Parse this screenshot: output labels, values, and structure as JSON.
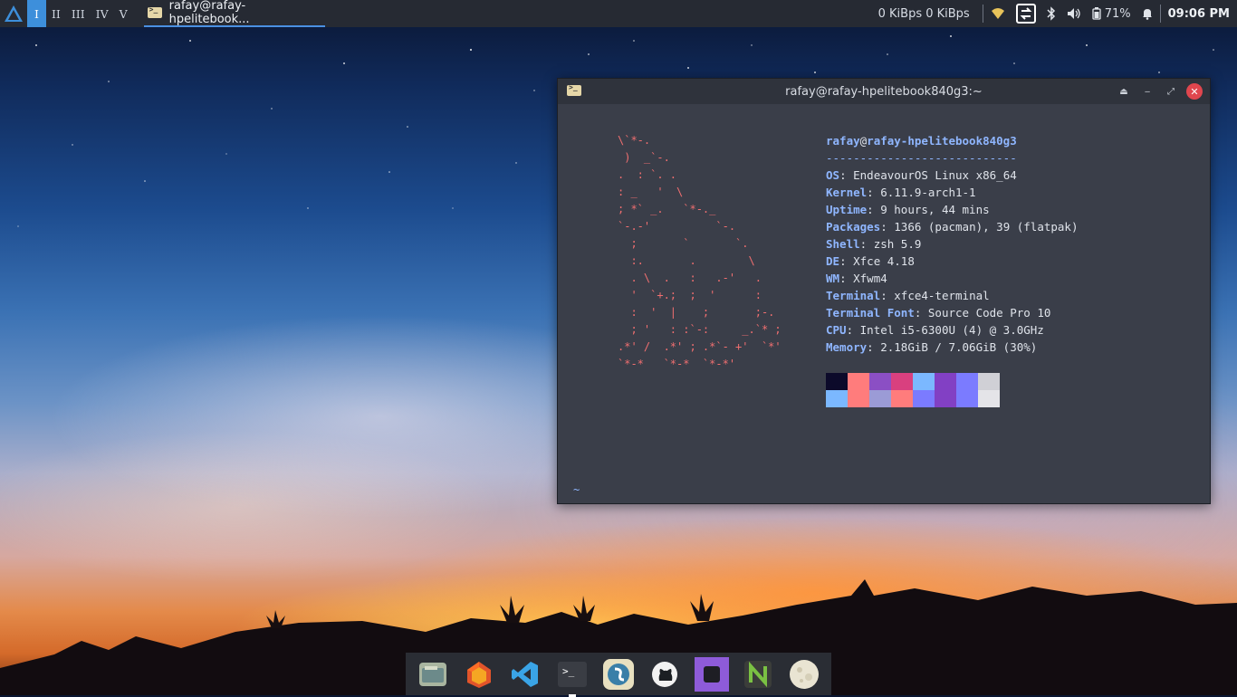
{
  "panel": {
    "workspaces": [
      "I",
      "II",
      "III",
      "IV",
      "V"
    ],
    "active_workspace": "I",
    "task_title": "rafay@rafay-hpelitebook...",
    "net_speed": "0 KiBps 0 KiBps",
    "battery": "71%",
    "clock": "09:06 PM",
    "tray_icons": [
      "wifi-icon",
      "screen-rotate-icon",
      "bluetooth-icon",
      "volume-icon",
      "battery-icon",
      "notification-bell-icon"
    ]
  },
  "terminal": {
    "title": "rafay@rafay-hpelitebook840g3:~",
    "ascii_art": "\\`*-.\n )  _`-.\n.  : `. .\n: _   '  \\\n; *` _.   `*-._\n`-.-'          `-.\n  ;       `       `.\n  :.       .        \\\n  . \\  .   :   .-'   .\n  '  `+.;  ;  '      :\n  :  '  |    ;       ;-.\n  ; '   : :`-:     _.`* ;\n.*' /  .*' ; .*`- +'  `*'\n`*-*   `*-*  `*-*'",
    "user": "rafay",
    "at": "@",
    "host": "rafay-hpelitebook840g3",
    "separator": "----------------------------",
    "info": [
      {
        "key": "OS",
        "value": "EndeavourOS Linux x86_64"
      },
      {
        "key": "Kernel",
        "value": "6.11.9-arch1-1"
      },
      {
        "key": "Uptime",
        "value": "9 hours, 44 mins"
      },
      {
        "key": "Packages",
        "value": "1366 (pacman), 39 (flatpak)"
      },
      {
        "key": "Shell",
        "value": "zsh 5.9"
      },
      {
        "key": "DE",
        "value": "Xfce 4.18"
      },
      {
        "key": "WM",
        "value": "Xfwm4"
      },
      {
        "key": "Terminal",
        "value": "xfce4-terminal"
      },
      {
        "key": "Terminal Font",
        "value": "Source Code Pro 10"
      },
      {
        "key": "CPU",
        "value": "Intel i5-6300U (4) @ 3.0GHz"
      },
      {
        "key": "Memory",
        "value": "2.18GiB / 7.06GiB (30%)"
      }
    ],
    "palette_colors": [
      "#0c0a2a",
      "#ff7c7c",
      "#8b4fc4",
      "#d9407f",
      "#7bb8ff",
      "#8240c4",
      "#7b7bff",
      "#d0d0d6",
      "#7bb8ff",
      "#ff7c7c",
      "#9b9bd6",
      "#ff7c7c",
      "#7b7bff",
      "#8240c4",
      "#7b7bff",
      "#e4e4e8"
    ],
    "prompt": "~"
  },
  "dock": {
    "apps": [
      "files-icon",
      "firefox-icon",
      "vscode-icon",
      "terminal-icon",
      "simplenote-icon",
      "github-icon",
      "app-square-icon",
      "neovim-icon",
      "moon-icon"
    ]
  }
}
